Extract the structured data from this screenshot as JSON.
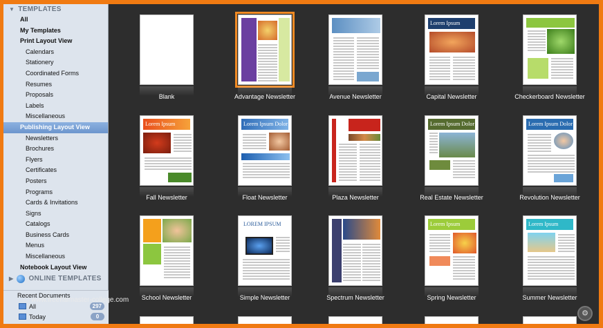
{
  "sidebar": {
    "templates_header": "TEMPLATES",
    "items": [
      {
        "label": "All",
        "level": 1
      },
      {
        "label": "My Templates",
        "level": 1
      },
      {
        "label": "Print Layout View",
        "level": 1
      },
      {
        "label": "Calendars",
        "level": 2
      },
      {
        "label": "Stationery",
        "level": 2
      },
      {
        "label": "Coordinated Forms",
        "level": 2
      },
      {
        "label": "Resumes",
        "level": 2
      },
      {
        "label": "Proposals",
        "level": 2
      },
      {
        "label": "Labels",
        "level": 2
      },
      {
        "label": "Miscellaneous",
        "level": 2
      },
      {
        "label": "Publishing Layout View",
        "level": 1,
        "selected": true
      },
      {
        "label": "Newsletters",
        "level": 2
      },
      {
        "label": "Brochures",
        "level": 2
      },
      {
        "label": "Flyers",
        "level": 2
      },
      {
        "label": "Certificates",
        "level": 2
      },
      {
        "label": "Posters",
        "level": 2
      },
      {
        "label": "Programs",
        "level": 2
      },
      {
        "label": "Cards & Invitations",
        "level": 2
      },
      {
        "label": "Signs",
        "level": 2
      },
      {
        "label": "Catalogs",
        "level": 2
      },
      {
        "label": "Business Cards",
        "level": 2
      },
      {
        "label": "Menus",
        "level": 2
      },
      {
        "label": "Miscellaneous",
        "level": 2
      },
      {
        "label": "Notebook Layout View",
        "level": 1
      }
    ],
    "online_header": "ONLINE TEMPLATES",
    "recent_header": "Recent Documents",
    "recent_rows": [
      {
        "label": "All",
        "count": "297"
      },
      {
        "label": "Today",
        "count": "0"
      }
    ]
  },
  "watermark": "www.freeflaimaster-college.com",
  "accent_color": "#f08a24",
  "templates": [
    {
      "name": "Blank",
      "style": "blank",
      "selected": false
    },
    {
      "name": "Advantage Newsletter",
      "style": "advantage",
      "selected": true
    },
    {
      "name": "Avenue Newsletter",
      "style": "avenue",
      "selected": false
    },
    {
      "name": "Capital Newsletter",
      "style": "capital",
      "heading": "Lorem Ipsum",
      "selected": false
    },
    {
      "name": "Checkerboard Newsletter",
      "style": "checker",
      "selected": false
    },
    {
      "name": "Fall Newsletter",
      "style": "fall",
      "heading": "Lorem Ipsum",
      "selected": false
    },
    {
      "name": "Float Newsletter",
      "style": "float",
      "heading": "Lorem Ipsum Dolor",
      "selected": false
    },
    {
      "name": "Plaza Newsletter",
      "style": "plaza",
      "selected": false
    },
    {
      "name": "Real Estate Newsletter",
      "style": "realestate",
      "heading": "Lorem Ipsum Dolor",
      "selected": false
    },
    {
      "name": "Revolution Newsletter",
      "style": "revolution",
      "heading": "Lorem Ipsum Dolor",
      "selected": false
    },
    {
      "name": "School Newsletter",
      "style": "school",
      "selected": false
    },
    {
      "name": "Simple Newsletter",
      "style": "simple",
      "heading": "LOREM IPSUM",
      "selected": false
    },
    {
      "name": "Spectrum Newsletter",
      "style": "spectrum",
      "selected": false
    },
    {
      "name": "Spring Newsletter",
      "style": "spring",
      "heading": "Lorem Ipsum",
      "selected": false
    },
    {
      "name": "Summer Newsletter",
      "style": "summer",
      "heading": "Lorem Ipsum",
      "selected": false
    }
  ]
}
